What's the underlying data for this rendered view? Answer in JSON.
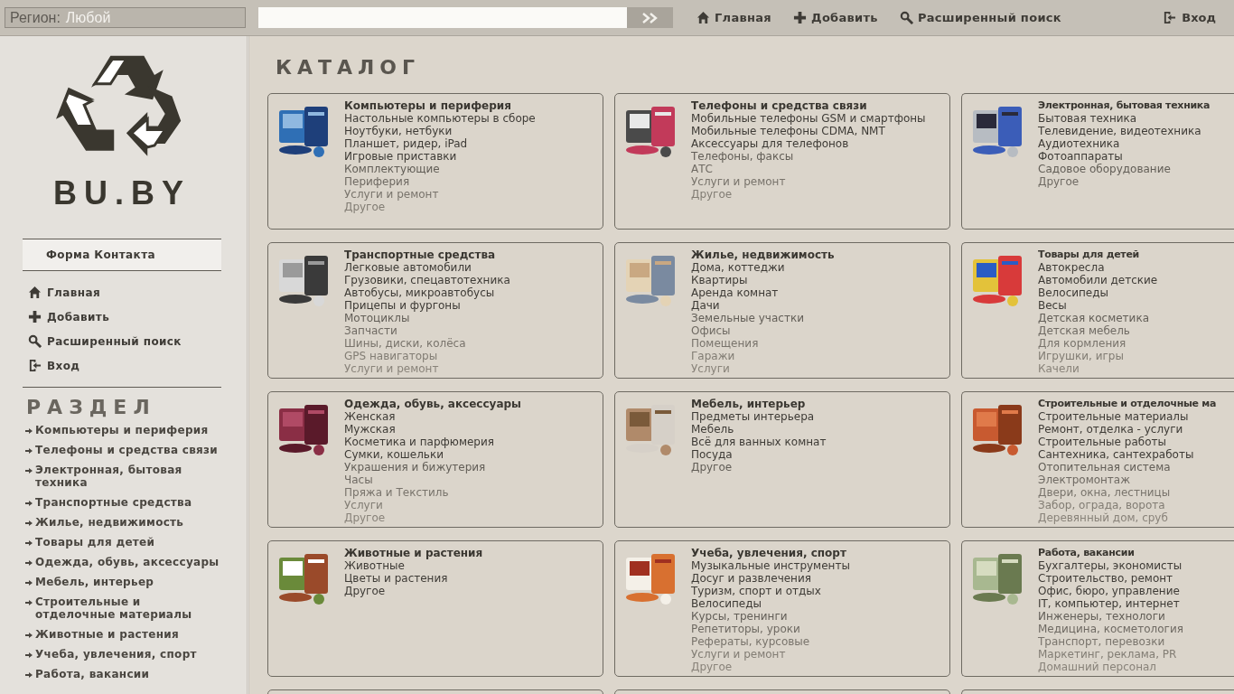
{
  "top_bar": {
    "region": {
      "label": "Регион:",
      "value": "Любой"
    },
    "nav": [
      {
        "kind": "home",
        "label": "Главная"
      },
      {
        "kind": "add",
        "label": "Добавить"
      },
      {
        "kind": "search",
        "label": "Расширенный поиск"
      }
    ],
    "login": {
      "kind": "login",
      "label": "Вход"
    }
  },
  "sidebar": {
    "logo_text": "BU.BY",
    "contact_button": "Форма Контакта",
    "menu": [
      {
        "kind": "home",
        "label": "Главная"
      },
      {
        "kind": "add",
        "label": "Добавить"
      },
      {
        "kind": "search",
        "label": "Расширенный поиск"
      },
      {
        "kind": "login",
        "label": "Вход"
      }
    ],
    "section_title": "РАЗДЕЛ",
    "sections": [
      "Компьютеры и периферия",
      "Телефоны и средства связи",
      "Электронная, бытовая техника",
      "Транспортные средства",
      "Жилье, недвижимость",
      "Товары для детей",
      "Одежда, обувь, аксессуары",
      "Мебель, интерьер",
      "Строительные и отделочные материалы",
      "Животные и растения",
      "Учеба, увлечения, спорт",
      "Работа, вакансии"
    ]
  },
  "catalog": {
    "title": "КАТАЛОГ",
    "categories": [
      {
        "title": "Компьютеры и периферия",
        "items": [
          {
            "text": "Настольные компьютеры в сборе",
            "kind": "dark"
          },
          {
            "text": "Ноутбуки, нетбуки",
            "kind": "dark"
          },
          {
            "text": "Планшет, ридер, iPad",
            "kind": "dark"
          },
          {
            "text": "Игровые приставки",
            "kind": "dark"
          },
          {
            "text": "Комплектующие",
            "kind": "mid"
          },
          {
            "text": "Периферия",
            "kind": "light"
          },
          {
            "text": "Услуги и ремонт",
            "kind": "pale"
          },
          {
            "text": "Другое",
            "kind": "faint"
          }
        ]
      },
      {
        "title": "Телефоны и средства связи",
        "items": [
          {
            "text": "Мобильные телефоны GSM и смартфоны",
            "kind": "dark"
          },
          {
            "text": "Мобильные телефоны CDMA, NMT",
            "kind": "dark"
          },
          {
            "text": "Аксессуары для телефонов",
            "kind": "dark"
          },
          {
            "text": "Телефоны, факсы",
            "kind": "mid"
          },
          {
            "text": "АТС",
            "kind": "light"
          },
          {
            "text": "Услуги и ремонт",
            "kind": "pale"
          },
          {
            "text": "Другое",
            "kind": "faint"
          }
        ]
      },
      {
        "title": "Электронная, бытовая техника",
        "items": [
          {
            "text": "Бытовая техника",
            "kind": "dark"
          },
          {
            "text": "Телевидение, видеотехника",
            "kind": "dark"
          },
          {
            "text": "Аудиотехника",
            "kind": "dark"
          },
          {
            "text": "Фотоаппараты",
            "kind": "dark"
          },
          {
            "text": "Садовое оборудование",
            "kind": "mid"
          },
          {
            "text": "Другое",
            "kind": "light"
          }
        ]
      },
      {
        "title": "Транспортные средства",
        "items": [
          {
            "text": "Легковые автомобили",
            "kind": "dark"
          },
          {
            "text": "Грузовики, спецавтотехника",
            "kind": "dark"
          },
          {
            "text": "Автобусы, микроавтобусы",
            "kind": "dark"
          },
          {
            "text": "Прицепы и фургоны",
            "kind": "dark"
          },
          {
            "text": "Мотоциклы",
            "kind": "mid"
          },
          {
            "text": "Запчасти",
            "kind": "light"
          },
          {
            "text": "Шины, диски, колёса",
            "kind": "pale"
          },
          {
            "text": "GPS навигаторы",
            "kind": "faint"
          },
          {
            "text": "Услуги и ремонт",
            "kind": "faintest"
          }
        ]
      },
      {
        "title": "Жилье, недвижимость",
        "items": [
          {
            "text": "Дома, коттеджи",
            "kind": "dark"
          },
          {
            "text": "Квартиры",
            "kind": "dark"
          },
          {
            "text": "Аренда комнат",
            "kind": "dark"
          },
          {
            "text": "Дачи",
            "kind": "dark"
          },
          {
            "text": "Земельные участки",
            "kind": "mid"
          },
          {
            "text": "Офисы",
            "kind": "light"
          },
          {
            "text": "Помещения",
            "kind": "pale"
          },
          {
            "text": "Гаражи",
            "kind": "faint"
          },
          {
            "text": "Услуги",
            "kind": "faintest"
          }
        ]
      },
      {
        "title": "Товары для детей",
        "items": [
          {
            "text": "Автокресла",
            "kind": "dark"
          },
          {
            "text": "Автомобили детские",
            "kind": "dark"
          },
          {
            "text": "Велосипеды",
            "kind": "dark"
          },
          {
            "text": "Весы",
            "kind": "dark"
          },
          {
            "text": "Детская косметика",
            "kind": "mid"
          },
          {
            "text": "Детская мебель",
            "kind": "light"
          },
          {
            "text": "Для кормления",
            "kind": "pale"
          },
          {
            "text": "Игрушки, игры",
            "kind": "faint"
          },
          {
            "text": "Качели",
            "kind": "faintest"
          }
        ]
      },
      {
        "title": "Одежда, обувь, аксессуары",
        "items": [
          {
            "text": "Женская",
            "kind": "dark"
          },
          {
            "text": "Мужская",
            "kind": "dark"
          },
          {
            "text": "Косметика и парфюмерия",
            "kind": "dark"
          },
          {
            "text": "Сумки, кошельки",
            "kind": "dark"
          },
          {
            "text": "Украшения и бижутерия",
            "kind": "mid"
          },
          {
            "text": "Часы",
            "kind": "light"
          },
          {
            "text": "Пряжа и Текстиль",
            "kind": "pale"
          },
          {
            "text": "Услуги",
            "kind": "faint"
          },
          {
            "text": "Другое",
            "kind": "faintest"
          }
        ]
      },
      {
        "title": "Мебель, интерьер",
        "items": [
          {
            "text": "Предметы интерьера",
            "kind": "dark"
          },
          {
            "text": "Мебель",
            "kind": "dark"
          },
          {
            "text": "Всё для ванных комнат",
            "kind": "dark"
          },
          {
            "text": "Посуда",
            "kind": "dark"
          },
          {
            "text": "Другое",
            "kind": "mid"
          }
        ]
      },
      {
        "title": "Строительные и отделочные ма",
        "items": [
          {
            "text": "Строительные материалы",
            "kind": "dark"
          },
          {
            "text": "Ремонт, отделка - услуги",
            "kind": "dark"
          },
          {
            "text": "Строительные работы",
            "kind": "dark"
          },
          {
            "text": "Сантехника, сантехработы",
            "kind": "dark"
          },
          {
            "text": "Отопительная система",
            "kind": "mid"
          },
          {
            "text": "Электромонтаж",
            "kind": "light"
          },
          {
            "text": "Двери, окна, лестницы",
            "kind": "pale"
          },
          {
            "text": "Забор, ограда, ворота",
            "kind": "faint"
          },
          {
            "text": "Деревянный дом, сруб",
            "kind": "faintest"
          }
        ]
      },
      {
        "title": "Животные и растения",
        "items": [
          {
            "text": "Животные",
            "kind": "dark"
          },
          {
            "text": "Цветы и растения",
            "kind": "dark"
          },
          {
            "text": "Другое",
            "kind": "dark"
          }
        ]
      },
      {
        "title": "Учеба, увлечения, спорт",
        "items": [
          {
            "text": "Музыкальные инструменты",
            "kind": "dark"
          },
          {
            "text": "Досуг и развлечения",
            "kind": "dark"
          },
          {
            "text": "Туризм, спорт и отдых",
            "kind": "dark"
          },
          {
            "text": "Велосипеды",
            "kind": "dark"
          },
          {
            "text": "Курсы, тренинги",
            "kind": "mid"
          },
          {
            "text": "Репетиторы, уроки",
            "kind": "light"
          },
          {
            "text": "Рефераты, курсовые",
            "kind": "pale"
          },
          {
            "text": "Услуги и ремонт",
            "kind": "faint"
          },
          {
            "text": "Другое",
            "kind": "faintest"
          }
        ]
      },
      {
        "title": "Работа, вакансии",
        "items": [
          {
            "text": "Бухгалтеры, экономисты",
            "kind": "dark"
          },
          {
            "text": "Строительство, ремонт",
            "kind": "dark"
          },
          {
            "text": "Офис, бюро, управление",
            "kind": "dark"
          },
          {
            "text": "IT, компьютер, интернет",
            "kind": "dark"
          },
          {
            "text": "Инженеры, технологи",
            "kind": "mid"
          },
          {
            "text": "Медицина, косметология",
            "kind": "light"
          },
          {
            "text": "Транспорт, перевозки",
            "kind": "pale"
          },
          {
            "text": "Маркетинг, реклама, PR",
            "kind": "faint"
          },
          {
            "text": "Домашний персонал",
            "kind": "faintest"
          }
        ]
      }
    ]
  }
}
